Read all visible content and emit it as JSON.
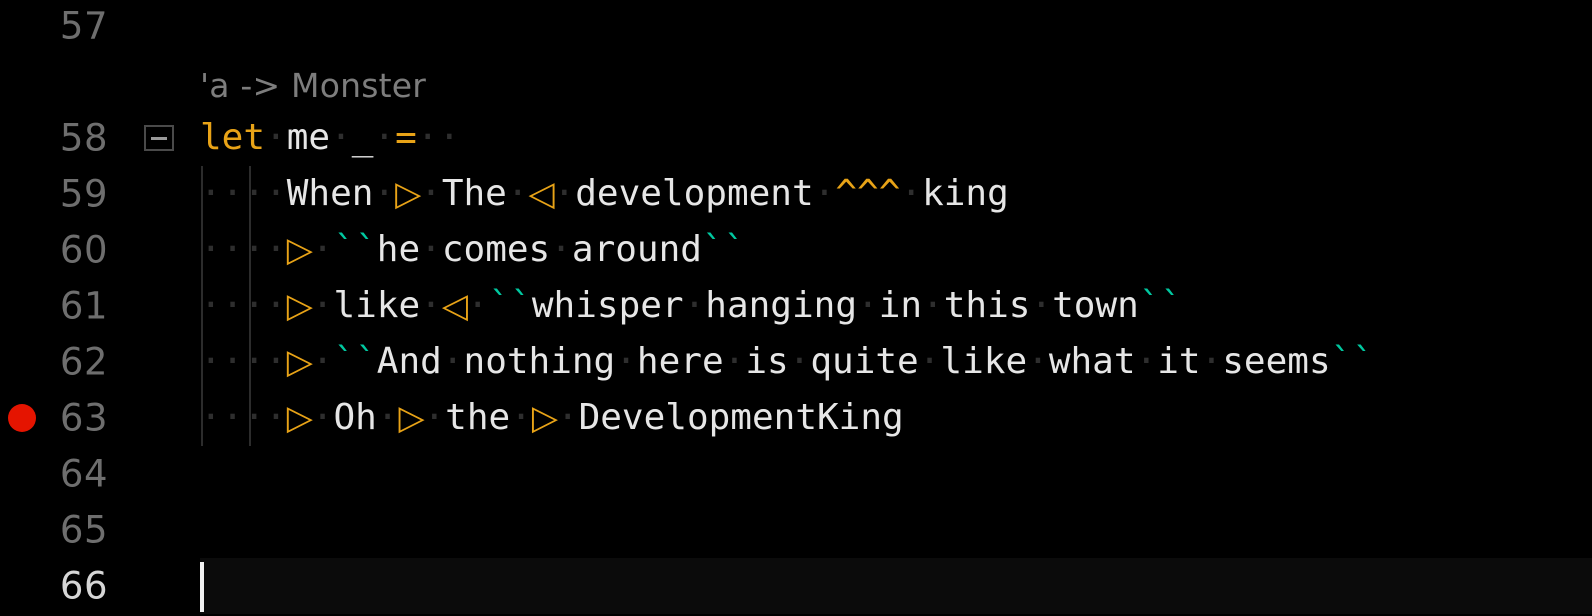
{
  "editor": {
    "theme_background": "#000000",
    "active_line_background": "#0B0B0B",
    "gutter_number_color": "#6E6E6E",
    "gutter_active_number_color": "#D6D6D6",
    "keyword_color": "#E8A317",
    "string_quote_color": "#00C8A0",
    "text_color": "#E6E6E6",
    "whitespace_dot_color": "#2E2E2E",
    "breakpoint_color": "#E51400",
    "indent_guide_color": "#2C2C2C",
    "cursor_color": "#F2F2F2",
    "whitespace_dot": "·",
    "triangle_right": "▷",
    "triangle_left": "◁"
  },
  "inlay_hint": {
    "text": "'a -> Monster"
  },
  "lines": [
    {
      "number": "57",
      "breakpoint": false,
      "fold": false,
      "active": false,
      "indent_guides": 0,
      "tokens": []
    },
    {
      "number": "58",
      "breakpoint": false,
      "fold": true,
      "active": false,
      "indent_guides": 0,
      "tokens": [
        {
          "kind": "kw",
          "text": "let"
        },
        {
          "kind": "ws-dot",
          "text": "·"
        },
        {
          "kind": "plain",
          "text": "me"
        },
        {
          "kind": "ws-dot",
          "text": "·"
        },
        {
          "kind": "plain",
          "text": "_"
        },
        {
          "kind": "ws-dot",
          "text": "·"
        },
        {
          "kind": "kw",
          "text": "="
        },
        {
          "kind": "ws-dot",
          "text": "·"
        },
        {
          "kind": "ws-dot",
          "text": "·"
        }
      ]
    },
    {
      "number": "59",
      "breakpoint": false,
      "fold": false,
      "active": false,
      "indent_guides": 2,
      "tokens": [
        {
          "kind": "ws-dot",
          "text": "·"
        },
        {
          "kind": "ws-dot",
          "text": "·"
        },
        {
          "kind": "ws-dot",
          "text": "·"
        },
        {
          "kind": "ws-dot",
          "text": "·"
        },
        {
          "kind": "plain",
          "text": "When"
        },
        {
          "kind": "ws-dot",
          "text": "·"
        },
        {
          "kind": "tri-r",
          "text": "▷"
        },
        {
          "kind": "ws-dot",
          "text": "·"
        },
        {
          "kind": "plain",
          "text": "The"
        },
        {
          "kind": "ws-dot",
          "text": "·"
        },
        {
          "kind": "tri-l",
          "text": "◁"
        },
        {
          "kind": "ws-dot",
          "text": "·"
        },
        {
          "kind": "plain",
          "text": "development"
        },
        {
          "kind": "ws-dot",
          "text": "·"
        },
        {
          "kind": "caret",
          "text": "^^^"
        },
        {
          "kind": "ws-dot",
          "text": "·"
        },
        {
          "kind": "plain",
          "text": "king"
        }
      ]
    },
    {
      "number": "60",
      "breakpoint": false,
      "fold": false,
      "active": false,
      "indent_guides": 2,
      "tokens": [
        {
          "kind": "ws-dot",
          "text": "·"
        },
        {
          "kind": "ws-dot",
          "text": "·"
        },
        {
          "kind": "ws-dot",
          "text": "·"
        },
        {
          "kind": "ws-dot",
          "text": "·"
        },
        {
          "kind": "tri-r",
          "text": "▷"
        },
        {
          "kind": "ws-dot",
          "text": "·"
        },
        {
          "kind": "tick",
          "text": "``"
        },
        {
          "kind": "plain",
          "text": "he"
        },
        {
          "kind": "ws-dot",
          "text": "·"
        },
        {
          "kind": "plain",
          "text": "comes"
        },
        {
          "kind": "ws-dot",
          "text": "·"
        },
        {
          "kind": "plain",
          "text": "around"
        },
        {
          "kind": "tick",
          "text": "``"
        }
      ]
    },
    {
      "number": "61",
      "breakpoint": false,
      "fold": false,
      "active": false,
      "indent_guides": 2,
      "tokens": [
        {
          "kind": "ws-dot",
          "text": "·"
        },
        {
          "kind": "ws-dot",
          "text": "·"
        },
        {
          "kind": "ws-dot",
          "text": "·"
        },
        {
          "kind": "ws-dot",
          "text": "·"
        },
        {
          "kind": "tri-r",
          "text": "▷"
        },
        {
          "kind": "ws-dot",
          "text": "·"
        },
        {
          "kind": "plain",
          "text": "like"
        },
        {
          "kind": "ws-dot",
          "text": "·"
        },
        {
          "kind": "tri-l",
          "text": "◁"
        },
        {
          "kind": "ws-dot",
          "text": "·"
        },
        {
          "kind": "tick",
          "text": "``"
        },
        {
          "kind": "plain",
          "text": "whisper"
        },
        {
          "kind": "ws-dot",
          "text": "·"
        },
        {
          "kind": "plain",
          "text": "hanging"
        },
        {
          "kind": "ws-dot",
          "text": "·"
        },
        {
          "kind": "plain",
          "text": "in"
        },
        {
          "kind": "ws-dot",
          "text": "·"
        },
        {
          "kind": "plain",
          "text": "this"
        },
        {
          "kind": "ws-dot",
          "text": "·"
        },
        {
          "kind": "plain",
          "text": "town"
        },
        {
          "kind": "tick",
          "text": "``"
        }
      ]
    },
    {
      "number": "62",
      "breakpoint": false,
      "fold": false,
      "active": false,
      "indent_guides": 2,
      "tokens": [
        {
          "kind": "ws-dot",
          "text": "·"
        },
        {
          "kind": "ws-dot",
          "text": "·"
        },
        {
          "kind": "ws-dot",
          "text": "·"
        },
        {
          "kind": "ws-dot",
          "text": "·"
        },
        {
          "kind": "tri-r",
          "text": "▷"
        },
        {
          "kind": "ws-dot",
          "text": "·"
        },
        {
          "kind": "tick",
          "text": "``"
        },
        {
          "kind": "plain",
          "text": "And"
        },
        {
          "kind": "ws-dot",
          "text": "·"
        },
        {
          "kind": "plain",
          "text": "nothing"
        },
        {
          "kind": "ws-dot",
          "text": "·"
        },
        {
          "kind": "plain",
          "text": "here"
        },
        {
          "kind": "ws-dot",
          "text": "·"
        },
        {
          "kind": "plain",
          "text": "is"
        },
        {
          "kind": "ws-dot",
          "text": "·"
        },
        {
          "kind": "plain",
          "text": "quite"
        },
        {
          "kind": "ws-dot",
          "text": "·"
        },
        {
          "kind": "plain",
          "text": "like"
        },
        {
          "kind": "ws-dot",
          "text": "·"
        },
        {
          "kind": "plain",
          "text": "what"
        },
        {
          "kind": "ws-dot",
          "text": "·"
        },
        {
          "kind": "plain",
          "text": "it"
        },
        {
          "kind": "ws-dot",
          "text": "·"
        },
        {
          "kind": "plain",
          "text": "seems"
        },
        {
          "kind": "tick",
          "text": "``"
        }
      ]
    },
    {
      "number": "63",
      "breakpoint": true,
      "fold": false,
      "active": false,
      "indent_guides": 2,
      "tokens": [
        {
          "kind": "ws-dot",
          "text": "·"
        },
        {
          "kind": "ws-dot",
          "text": "·"
        },
        {
          "kind": "ws-dot",
          "text": "·"
        },
        {
          "kind": "ws-dot",
          "text": "·"
        },
        {
          "kind": "tri-r",
          "text": "▷"
        },
        {
          "kind": "ws-dot",
          "text": "·"
        },
        {
          "kind": "plain",
          "text": "Oh"
        },
        {
          "kind": "ws-dot",
          "text": "·"
        },
        {
          "kind": "tri-r",
          "text": "▷"
        },
        {
          "kind": "ws-dot",
          "text": "·"
        },
        {
          "kind": "plain",
          "text": "the"
        },
        {
          "kind": "ws-dot",
          "text": "·"
        },
        {
          "kind": "tri-r",
          "text": "▷"
        },
        {
          "kind": "ws-dot",
          "text": "·"
        },
        {
          "kind": "plain",
          "text": "DevelopmentKing"
        }
      ]
    },
    {
      "number": "64",
      "breakpoint": false,
      "fold": false,
      "active": false,
      "indent_guides": 0,
      "tokens": []
    },
    {
      "number": "65",
      "breakpoint": false,
      "fold": false,
      "active": false,
      "indent_guides": 0,
      "tokens": []
    },
    {
      "number": "66",
      "breakpoint": false,
      "fold": false,
      "active": true,
      "cursor": true,
      "indent_guides": 0,
      "tokens": []
    }
  ]
}
